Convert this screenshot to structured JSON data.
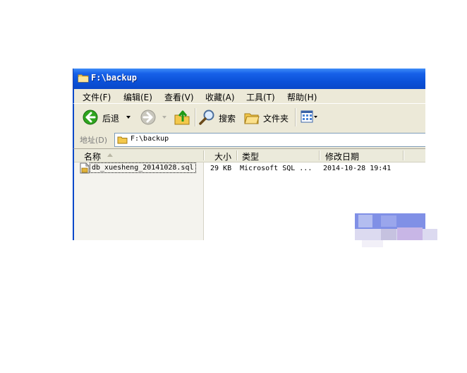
{
  "window": {
    "title": "F:\\backup"
  },
  "menu": {
    "items": [
      "文件(F)",
      "编辑(E)",
      "查看(V)",
      "收藏(A)",
      "工具(T)",
      "帮助(H)"
    ]
  },
  "toolbar": {
    "back_label": "后退",
    "search_label": "搜索",
    "folders_label": "文件夹"
  },
  "address": {
    "label": "地址(D)",
    "value": "F:\\backup"
  },
  "columns": {
    "name": "名称",
    "size": "大小",
    "type": "类型",
    "modified": "修改日期"
  },
  "files": [
    {
      "name": "db_xuesheng_20141028.sql",
      "size": "29 KB",
      "type": "Microsoft SQL ...",
      "modified": "2014-10-28 19:41"
    }
  ],
  "icons": [
    "folder-icon",
    "back-arrow-icon",
    "dropdown-arrow-icon",
    "forward-arrow-icon",
    "up-folder-icon",
    "search-icon",
    "folders-icon",
    "views-icon",
    "sort-arrow-icon",
    "sql-file-icon"
  ],
  "colors": {
    "titlebar": "#0a48c9",
    "chrome": "#ece9d8",
    "back_button": "#2ea41e"
  }
}
